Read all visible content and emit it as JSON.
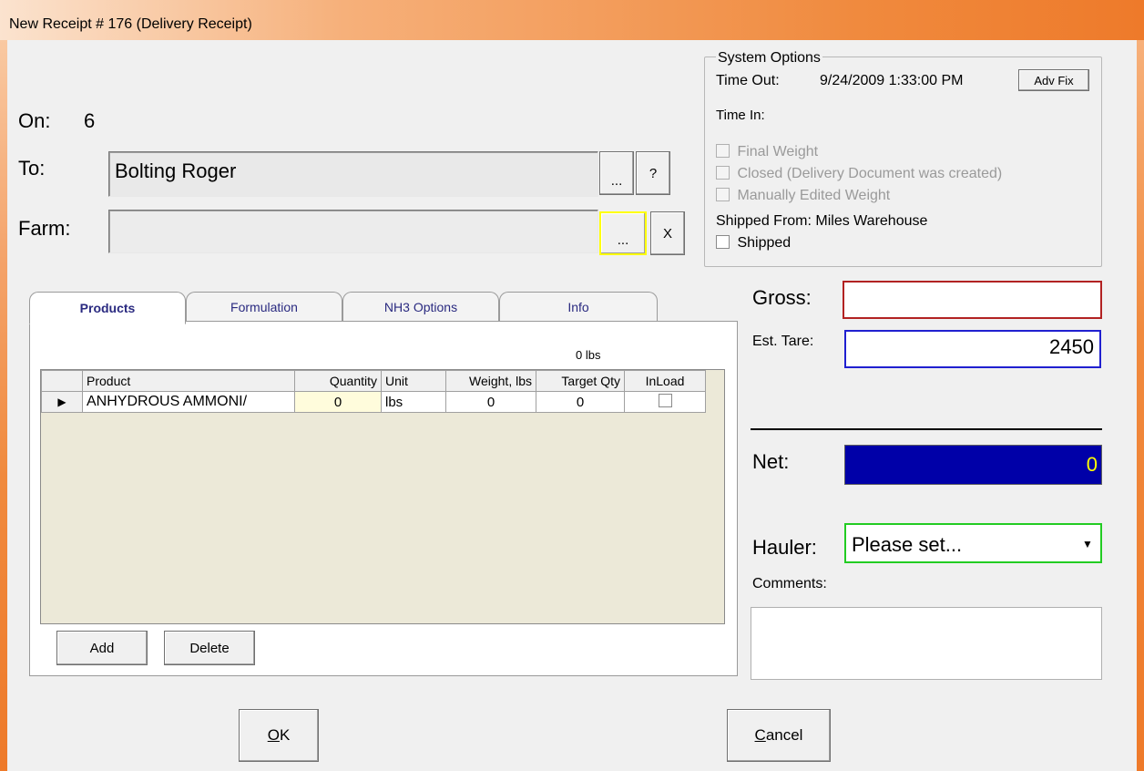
{
  "window": {
    "title": "New Receipt # 176 (Delivery Receipt)"
  },
  "header": {
    "on_label": "On:",
    "on_value": "6",
    "to_label": "To:",
    "to_value": "Bolting Roger",
    "to_browse": "...",
    "to_help": "?",
    "farm_label": "Farm:",
    "farm_value": "",
    "farm_browse": "...",
    "farm_clear": "X"
  },
  "system_options": {
    "title": "System Options",
    "time_out_label": "Time Out:",
    "time_out_value": "9/24/2009 1:33:00 PM",
    "adv_fix": "Adv Fix",
    "time_in_label": "Time In:",
    "final_weight": "Final Weight",
    "closed": "Closed (Delivery Document was created)",
    "manually_edited": "Manually Edited Weight",
    "shipped_from": "Shipped From: Miles Warehouse",
    "shipped": "Shipped"
  },
  "tabs": [
    "Products",
    "Formulation",
    "NH3 Options",
    "Info"
  ],
  "products": {
    "total_weight": "0 lbs",
    "columns": [
      "Product",
      "Quantity",
      "Unit",
      "Weight, lbs",
      "Target Qty",
      "InLoad"
    ],
    "rows": [
      {
        "indicator": "▶",
        "product": "ANHYDROUS AMMONI/",
        "quantity": "0",
        "unit": "lbs",
        "weight": "0",
        "target": "0",
        "inload": false
      }
    ],
    "add": "Add",
    "delete": "Delete"
  },
  "weights": {
    "gross_label": "Gross:",
    "gross_value": "",
    "tare_label": "Est. Tare:",
    "tare_value": "2450",
    "net_label": "Net:",
    "net_value": "0"
  },
  "hauler": {
    "label": "Hauler:",
    "value": "Please set...",
    "comments_label": "Comments:",
    "comments_value": ""
  },
  "footer": {
    "ok_accel": "O",
    "ok_rest": "K",
    "cancel_accel": "C",
    "cancel_rest": "ancel"
  },
  "colors": {
    "net_bg": "#0000a8",
    "net_fg": "#ffff00",
    "gross_border": "#b22222",
    "tare_border": "#2020d0",
    "hauler_border": "#22cc22",
    "farm_highlight": "#ffff00"
  }
}
